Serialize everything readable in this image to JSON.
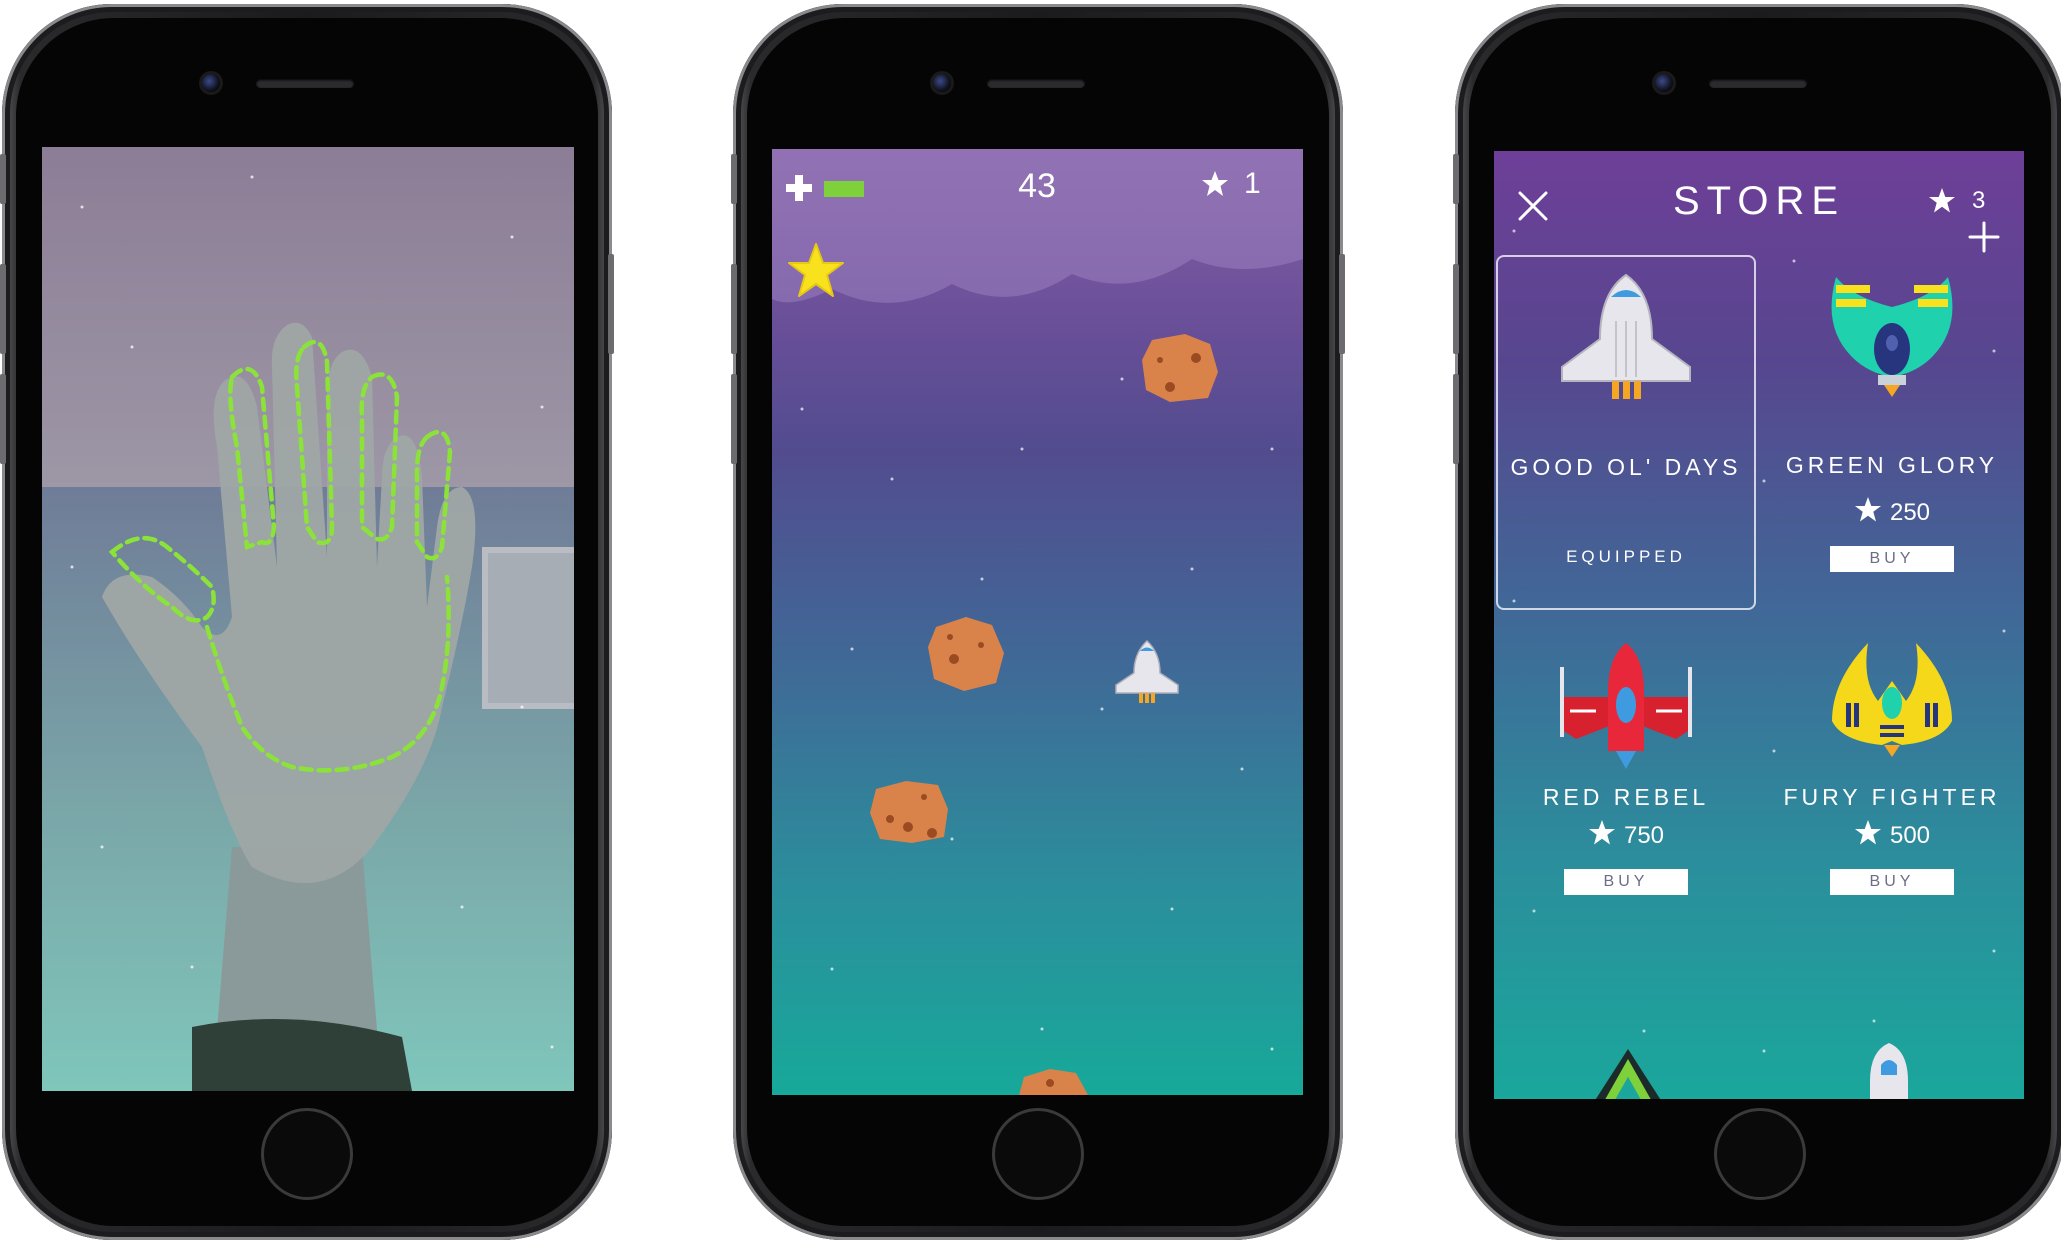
{
  "game": {
    "score": "43",
    "stars": "1"
  },
  "store": {
    "title": "STORE",
    "star_balance": "3",
    "items": [
      {
        "name": "GOOD OL' DAYS",
        "status": "EQUIPPED"
      },
      {
        "name": "GREEN GLORY",
        "price": "250",
        "button": "BUY"
      },
      {
        "name": "RED REBEL",
        "price": "750",
        "button": "BUY"
      },
      {
        "name": "FURY FIGHTER",
        "price": "500",
        "button": "BUY"
      }
    ]
  },
  "colors": {
    "hand_outline": "#8be33a",
    "health_bar": "#7fd13b",
    "star_yellow": "#f7e21d",
    "asteroid": "#d9834a"
  }
}
